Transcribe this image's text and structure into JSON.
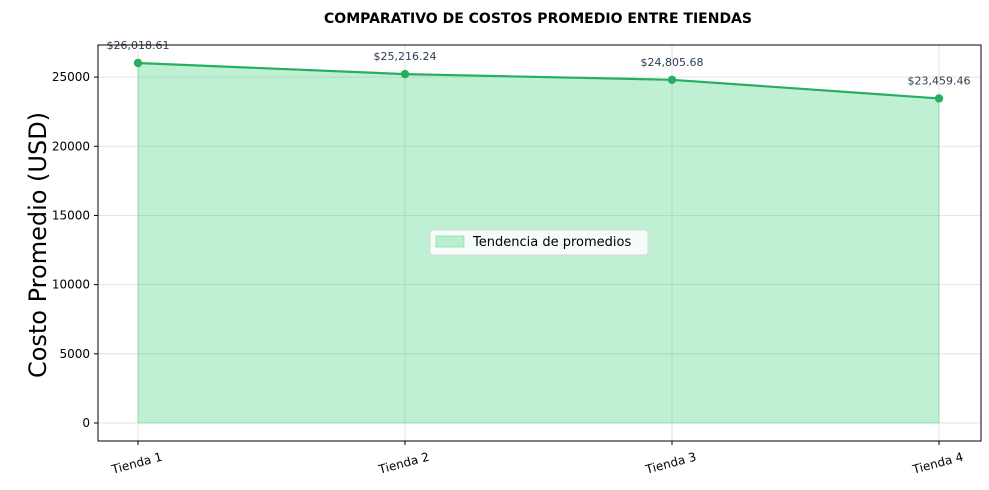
{
  "chart_data": {
    "type": "area",
    "title": "COMPARATIVO DE COSTOS PROMEDIO ENTRE TIENDAS",
    "xlabel": "",
    "ylabel": "Costo Promedio (USD)",
    "categories": [
      "Tienda 1",
      "Tienda 2",
      "Tienda 3",
      "Tienda 4"
    ],
    "series": [
      {
        "name": "Tendencia de promedios",
        "values": [
          26018.61,
          25216.24,
          24805.68,
          23459.46
        ],
        "labels": [
          "$26,018.61",
          "$25,216.24",
          "$24,805.68",
          "$23,459.46"
        ],
        "line_color": "#27ae60",
        "fill_color": "#2ecc71"
      }
    ],
    "yticks": [
      "0",
      "5000",
      "10000",
      "15000",
      "20000",
      "25000"
    ],
    "ytick_values": [
      0,
      5000,
      10000,
      15000,
      20000,
      25000
    ],
    "ylim": [
      -1300,
      27320
    ],
    "grid": true,
    "legend_position": "center"
  }
}
